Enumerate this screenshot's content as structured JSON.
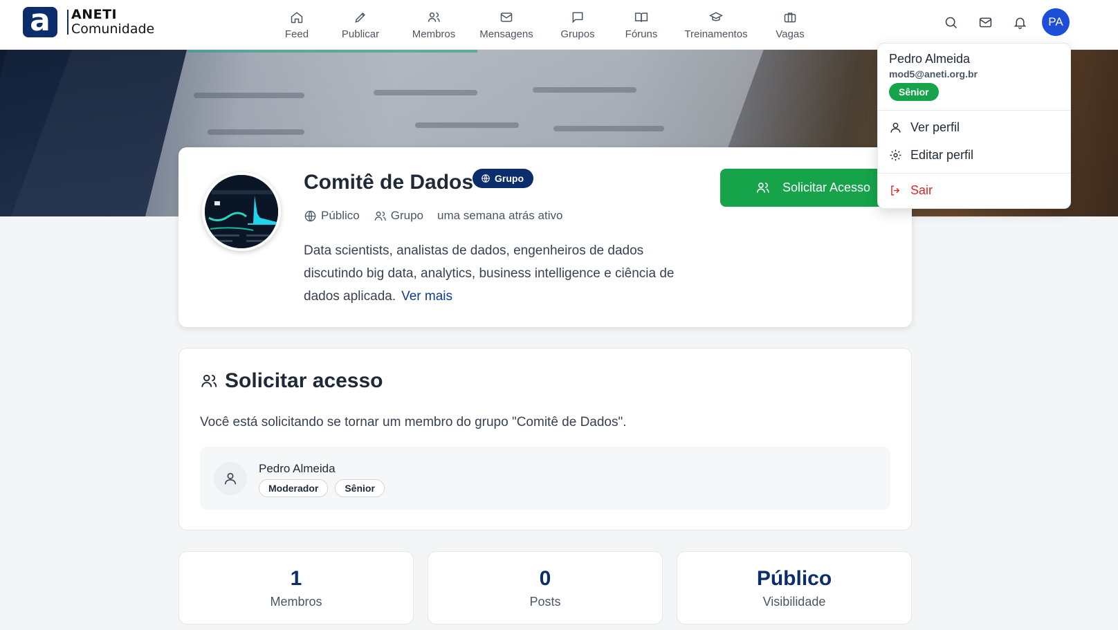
{
  "brand": {
    "mark": "a",
    "line1": "ANETI",
    "line2": "Comunidade"
  },
  "nav": [
    {
      "label": "Feed",
      "icon": "home-icon"
    },
    {
      "label": "Publicar",
      "icon": "pen-icon"
    },
    {
      "label": "Membros",
      "icon": "users-icon"
    },
    {
      "label": "Mensagens",
      "icon": "mail-icon"
    },
    {
      "label": "Grupos",
      "icon": "message-square-icon"
    },
    {
      "label": "Fóruns",
      "icon": "book-open-icon"
    },
    {
      "label": "Treinamentos",
      "icon": "graduation-cap-icon"
    },
    {
      "label": "Vagas",
      "icon": "briefcase-icon"
    }
  ],
  "user": {
    "initials": "PA",
    "name": "Pedro Almeida",
    "email": "mod5@aneti.org.br",
    "level": "Sênior",
    "role": "Moderador"
  },
  "dropdown": {
    "view_profile": "Ver perfil",
    "edit_profile": "Editar perfil",
    "logout": "Sair"
  },
  "group": {
    "name": "Comitê de Dados",
    "badge": "Grupo",
    "visibility": "Público",
    "type": "Grupo",
    "activity": "uma semana atrás ativo",
    "description": "Data scientists, analistas de dados, engenheiros de dados discutindo big data, analytics, business intelligence e ciência de dados aplicada.",
    "more": "Ver mais",
    "request_button": "Solicitar Acesso"
  },
  "access": {
    "title": "Solicitar acesso",
    "text": "Você está solicitando se tornar um membro do grupo \"Comitê de Dados\"."
  },
  "stats": [
    {
      "value": "1",
      "label": "Membros"
    },
    {
      "value": "0",
      "label": "Posts"
    },
    {
      "value": "Público",
      "label": "Visibilidade"
    }
  ],
  "colors": {
    "brand": "#0b2d6b",
    "primary_green": "#16a34a",
    "avatar_blue": "#1d4ed8",
    "danger": "#dc2626"
  }
}
